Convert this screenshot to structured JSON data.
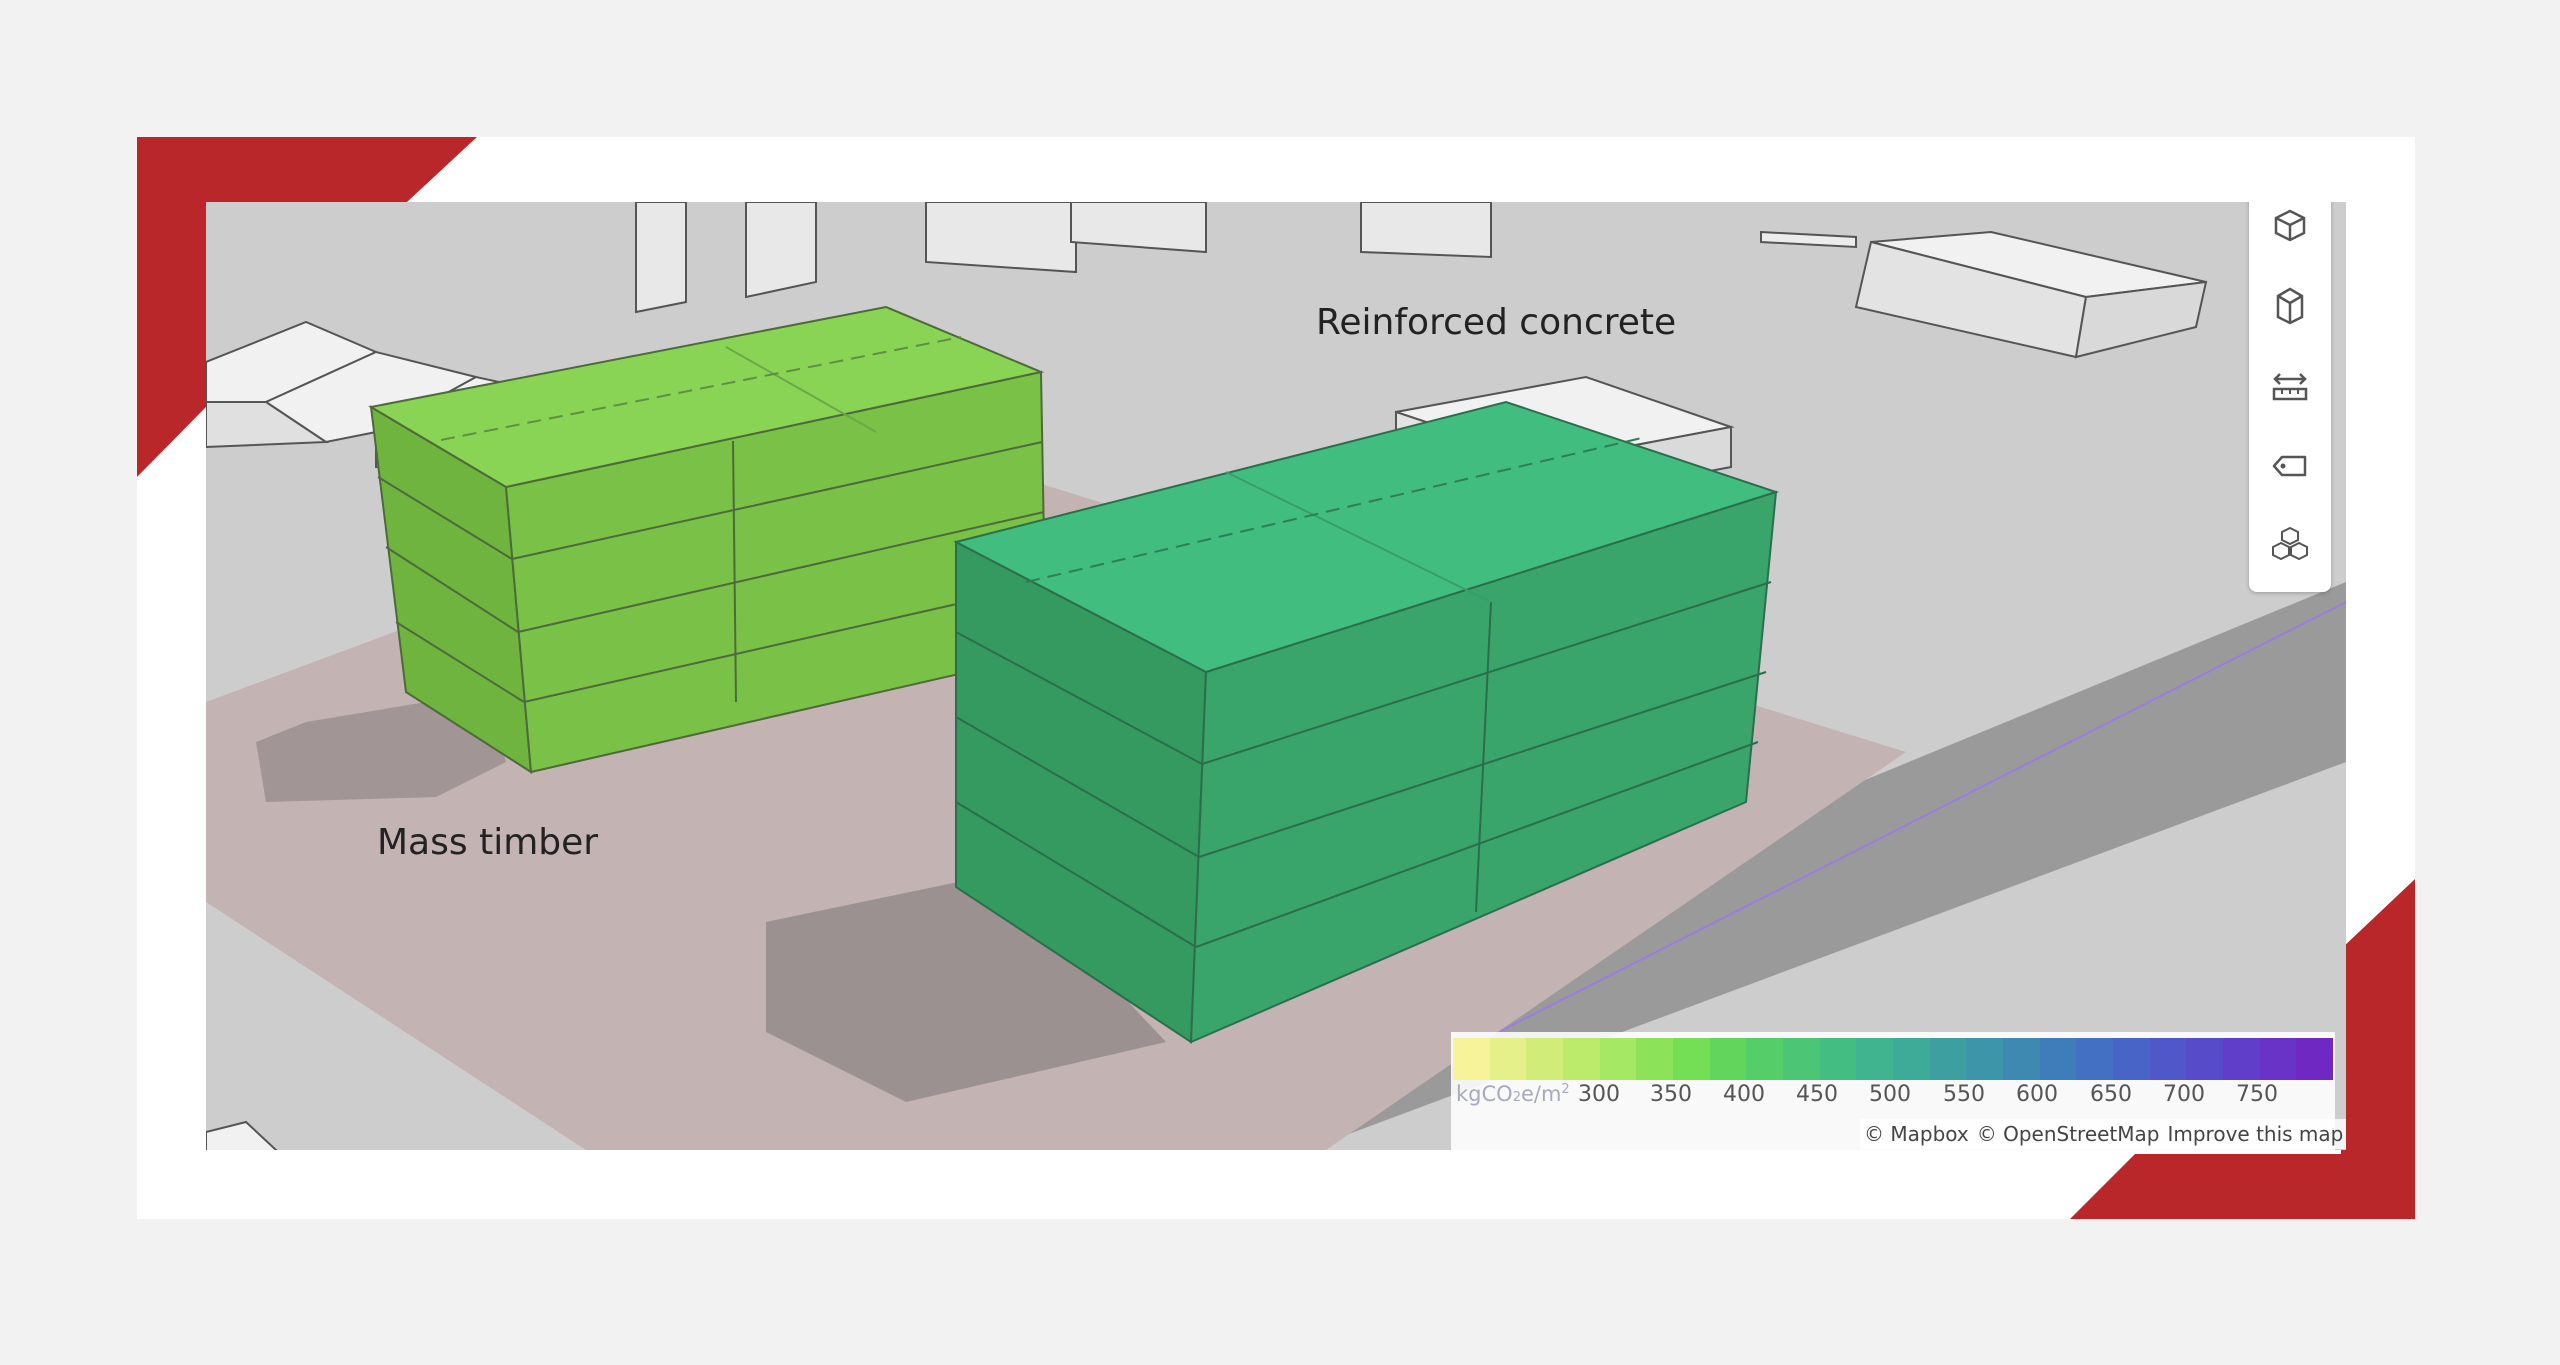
{
  "labels": {
    "reinforced_concrete": "Reinforced concrete",
    "mass_timber": "Mass timber"
  },
  "toolbar": {
    "buttons": [
      "view-3d",
      "building-select",
      "measure",
      "tag",
      "massing"
    ]
  },
  "legend": {
    "unit_main": "kgCO",
    "unit_sub": "2",
    "unit_mid": "e/m",
    "unit_sup": "2",
    "ticks": [
      "300",
      "350",
      "400",
      "450",
      "500",
      "550",
      "600",
      "650",
      "700",
      "750"
    ],
    "colors": [
      "#f7f39a",
      "#e6f08a",
      "#d2ec7a",
      "#bceb6c",
      "#a5e863",
      "#8ce35a",
      "#74de55",
      "#62d65c",
      "#55cd68",
      "#4cc574",
      "#44bd82",
      "#3fb48f",
      "#3eaa98",
      "#3d9fa0",
      "#3c95a8",
      "#3d89b2",
      "#3f7cba",
      "#4470c3",
      "#4964c7",
      "#5058c9",
      "#584bca",
      "#603ec9",
      "#6833c6",
      "#7028c2"
    ]
  },
  "attribution": {
    "mapbox": "© Mapbox",
    "osm": "© OpenStreetMap",
    "improve": "Improve this map"
  },
  "colors": {
    "accent_red": "#b9272a",
    "timber_green": "#78c446",
    "concrete_green": "#3aa86f",
    "site_pink": "#c4b3b3"
  }
}
